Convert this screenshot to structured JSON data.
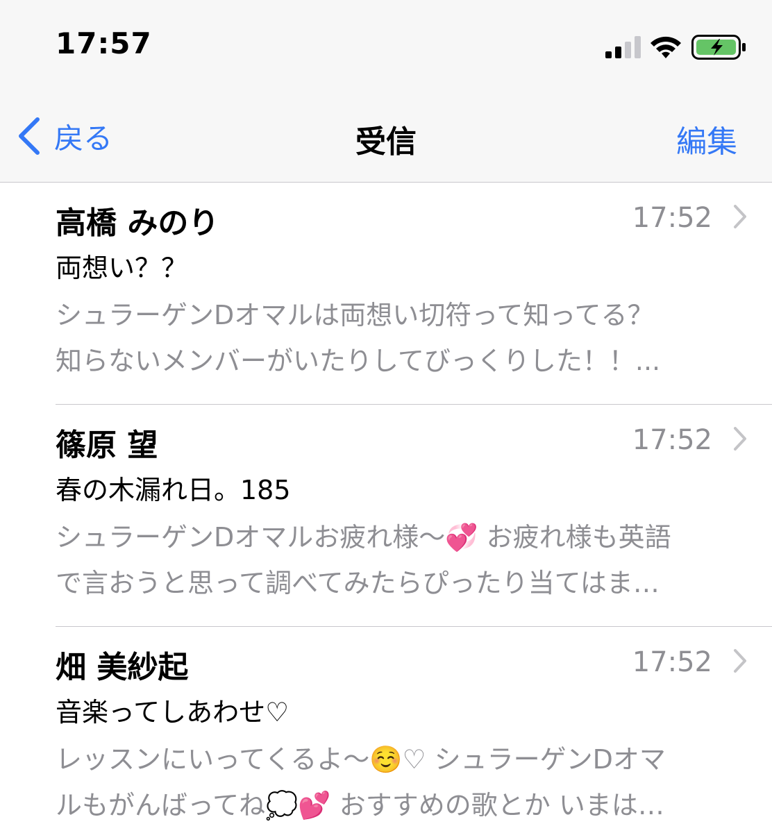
{
  "status_bar": {
    "time": "17:57",
    "icons": [
      "signal-icon",
      "wifi-icon",
      "battery-charging-icon"
    ]
  },
  "nav": {
    "back_label": "戻る",
    "title": "受信",
    "edit_label": "編集"
  },
  "colors": {
    "accent": "#3478f6",
    "secondary_text": "#8e8e93",
    "battery_green": "#65c466"
  },
  "messages": [
    {
      "sender": "高橋 みのり",
      "time": "17:52",
      "subject": "両想い？？",
      "preview": "シュラーゲンDオマルは両想い切符って知ってる？\n知らないメンバーがいたりしてびっくりした！！..."
    },
    {
      "sender": "篠原 望",
      "time": "17:52",
      "subject": "春の木漏れ日。185",
      "preview": "シュラーゲンDオマルお疲れ様〜💞 お疲れ様も英語\nで言おうと思って調べてみたらぴったり当てはま…"
    },
    {
      "sender": "畑 美紗起",
      "time": "17:52",
      "subject": "音楽ってしあわせ♡",
      "preview": "レッスンにいってくるよ〜☺️♡ シュラーゲンDオマ\nルもがんばってね💭💕 おすすめの歌とか いまは…"
    }
  ]
}
